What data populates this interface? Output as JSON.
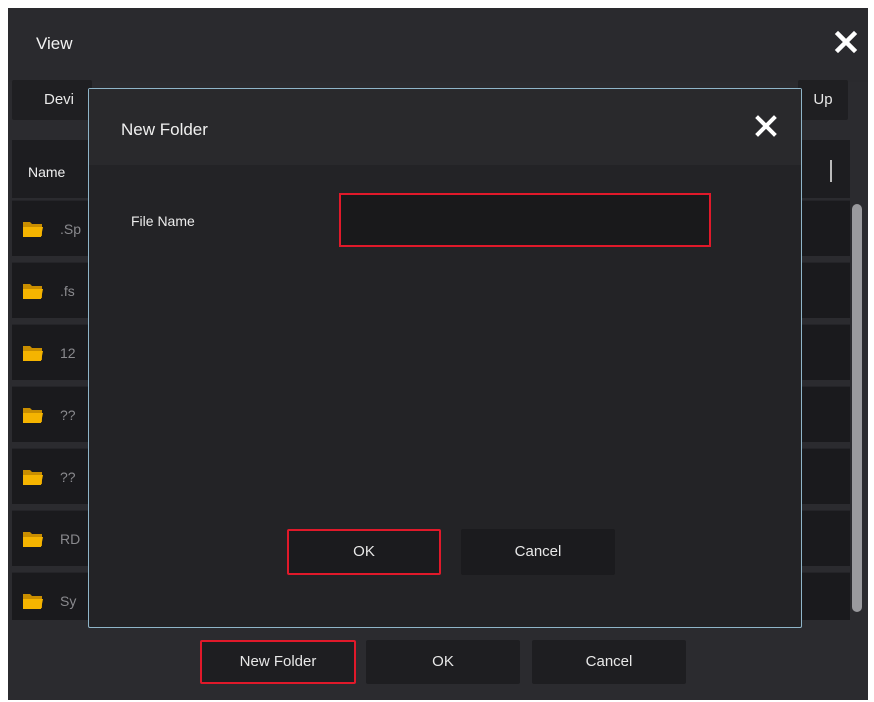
{
  "window": {
    "title": "View"
  },
  "toolbar": {
    "device_label": "Devi",
    "up_label": "Up"
  },
  "file_list": {
    "column_name": "Name",
    "rows": [
      {
        "name": ".Sp"
      },
      {
        "name": ".fs"
      },
      {
        "name": "12"
      },
      {
        "name": "??"
      },
      {
        "name": "??"
      },
      {
        "name": "RD"
      },
      {
        "name": "Sy"
      }
    ]
  },
  "bottom_buttons": {
    "new_folder": "New Folder",
    "ok": "OK",
    "cancel": "Cancel"
  },
  "dialog": {
    "title": "New Folder",
    "file_name_label": "File Name",
    "file_name_value": "",
    "ok": "OK",
    "cancel": "Cancel"
  },
  "colors": {
    "highlight": "#e0192a",
    "folder": "#f5b400",
    "dialog_border": "#8fb5c9"
  },
  "icons": {
    "close": "close-icon",
    "folder": "folder-icon"
  }
}
